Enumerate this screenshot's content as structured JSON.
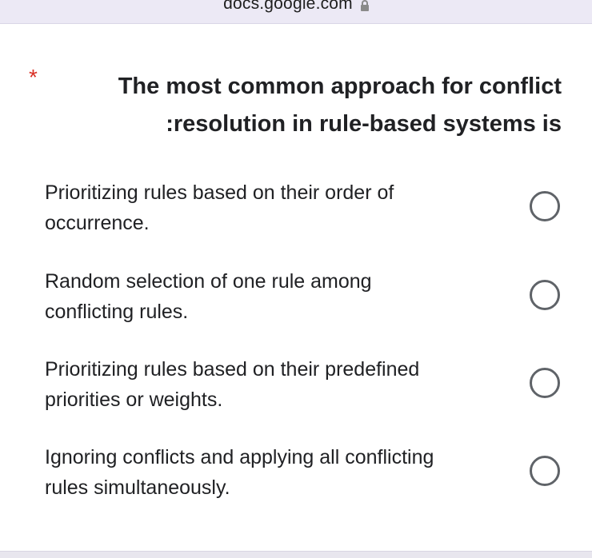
{
  "browser": {
    "url": "docs.google.com",
    "lock_icon": "lock-icon"
  },
  "question": {
    "required_marker": "*",
    "title_line1": "The most common approach for conflict",
    "title_line2": ":resolution in rule-based systems is",
    "accent_required_color": "#d93025"
  },
  "options": [
    {
      "line1": "Prioritizing rules based on their order of",
      "line2": "occurrence.",
      "selected": false
    },
    {
      "line1": "Random selection of one rule among",
      "line2": "conflicting rules.",
      "selected": false
    },
    {
      "line1": "Prioritizing rules based on their predefined",
      "line2": "priorities or weights.",
      "selected": false
    },
    {
      "line1": "Ignoring conflicts and applying all conflicting",
      "line2": "rules simultaneously.",
      "selected": false
    }
  ]
}
